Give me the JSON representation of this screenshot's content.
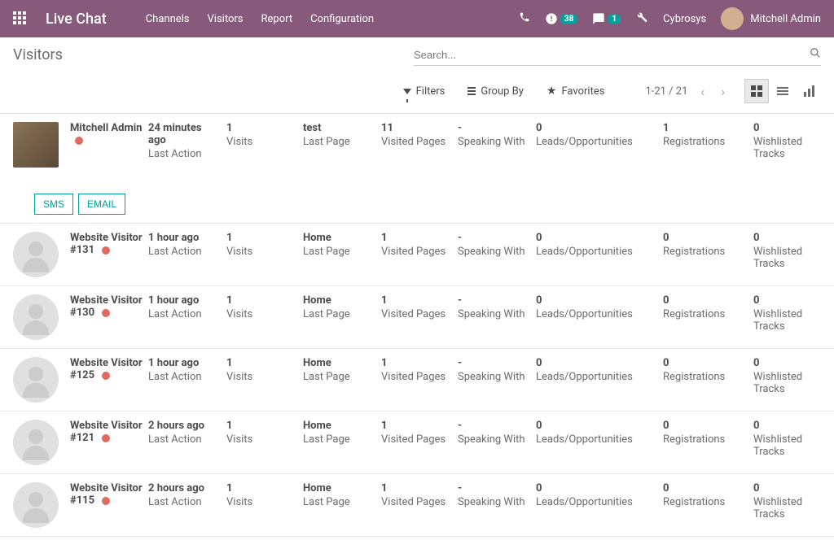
{
  "header": {
    "app_title": "Live Chat",
    "nav": [
      "Channels",
      "Visitors",
      "Report",
      "Configuration"
    ],
    "badge_activities": "38",
    "badge_messages": "1",
    "company": "Cybrosys",
    "user": "Mitchell Admin"
  },
  "control": {
    "breadcrumb": "Visitors",
    "search_placeholder": "Search...",
    "filters_label": "Filters",
    "groupby_label": "Group By",
    "favorites_label": "Favorites",
    "pager": "1-21 / 21"
  },
  "column_labels": {
    "last_action": "Last Action",
    "visits": "Visits",
    "last_page": "Last Page",
    "visited_pages": "Visited Pages",
    "speaking_with": "Speaking With",
    "leads": "Leads/Opportunities",
    "registrations": "Registrations",
    "wishlisted": "Wishlisted Tracks"
  },
  "actions": {
    "sms": "SMS",
    "email": "EMAIL"
  },
  "visitors": [
    {
      "name": "Mitchell Admin",
      "has_avatar": true,
      "last_action": "24 minutes ago",
      "visits": "1",
      "last_page": "test",
      "visited_pages": "11",
      "speaking_with": "-",
      "leads": "0",
      "registrations": "1",
      "wishlisted": "0",
      "show_actions": true
    },
    {
      "name": "Website Visitor #131",
      "has_avatar": false,
      "last_action": "1 hour ago",
      "visits": "1",
      "last_page": "Home",
      "visited_pages": "1",
      "speaking_with": "-",
      "leads": "0",
      "registrations": "0",
      "wishlisted": "0",
      "show_actions": false
    },
    {
      "name": "Website Visitor #130",
      "has_avatar": false,
      "last_action": "1 hour ago",
      "visits": "1",
      "last_page": "Home",
      "visited_pages": "1",
      "speaking_with": "-",
      "leads": "0",
      "registrations": "0",
      "wishlisted": "0",
      "show_actions": false
    },
    {
      "name": "Website Visitor #125",
      "has_avatar": false,
      "last_action": "1 hour ago",
      "visits": "1",
      "last_page": "Home",
      "visited_pages": "1",
      "speaking_with": "-",
      "leads": "0",
      "registrations": "0",
      "wishlisted": "0",
      "show_actions": false
    },
    {
      "name": "Website Visitor #121",
      "has_avatar": false,
      "last_action": "2 hours ago",
      "visits": "1",
      "last_page": "Home",
      "visited_pages": "1",
      "speaking_with": "-",
      "leads": "0",
      "registrations": "0",
      "wishlisted": "0",
      "show_actions": false
    },
    {
      "name": "Website Visitor #115",
      "has_avatar": false,
      "last_action": "2 hours ago",
      "visits": "1",
      "last_page": "Home",
      "visited_pages": "1",
      "speaking_with": "-",
      "leads": "0",
      "registrations": "0",
      "wishlisted": "0",
      "show_actions": false
    }
  ]
}
